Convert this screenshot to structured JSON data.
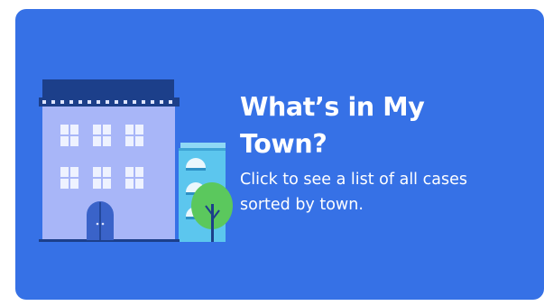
{
  "card": {
    "title": "What’s in My Town?",
    "description": "Click to see a list of all cases sorted by town.",
    "background_color": "#3671E6"
  },
  "illustration": {
    "building_color": "#A8B6F8",
    "roof_color": "#1C3F8A",
    "annex_color": "#5CC6EE",
    "tree_color": "#5BC85D"
  }
}
